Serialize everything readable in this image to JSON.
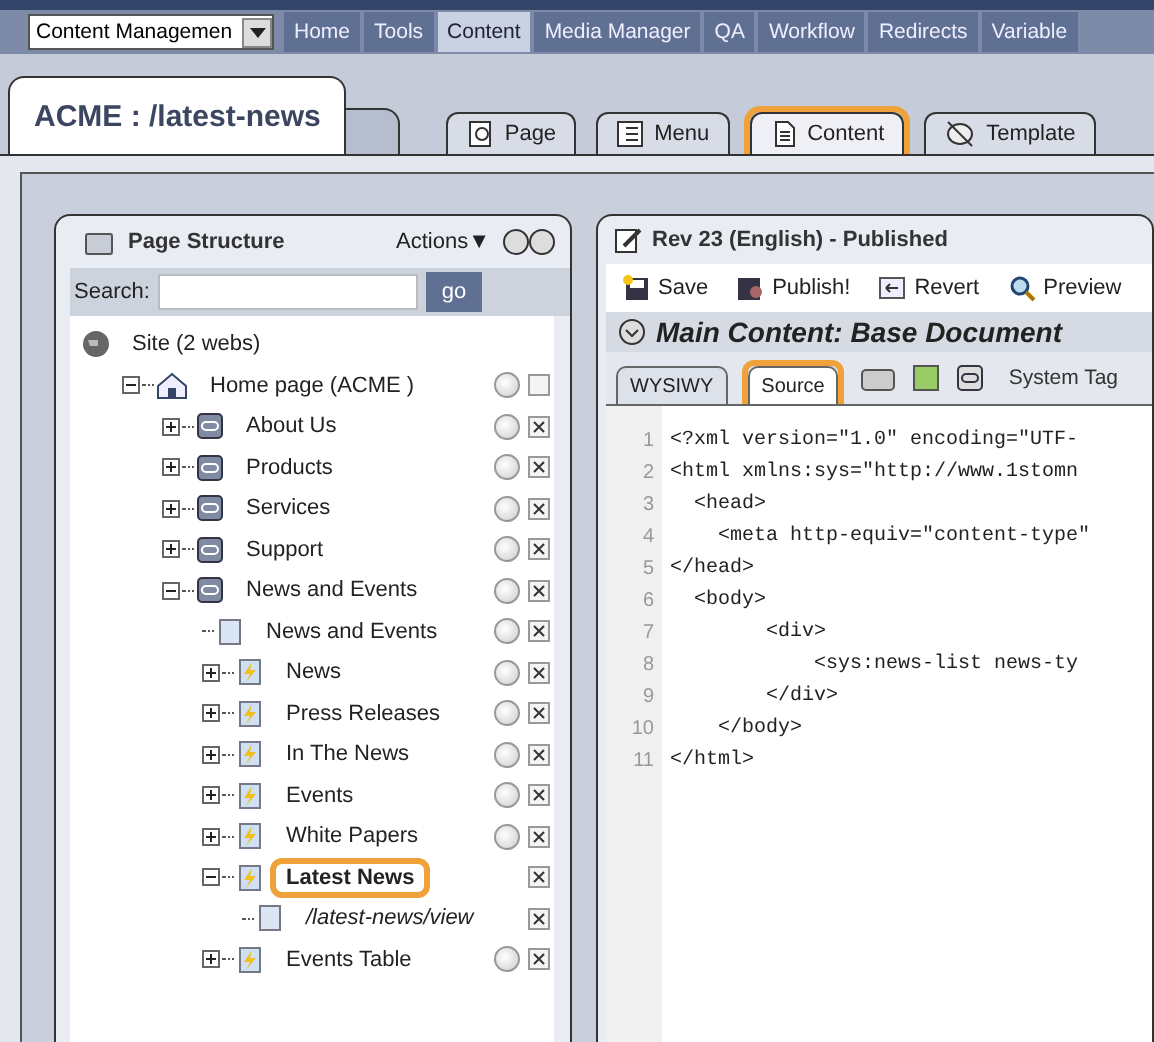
{
  "menu_bar": {
    "module_select": "Content Managemen",
    "items": [
      {
        "label": "Home",
        "selected": false
      },
      {
        "label": "Tools",
        "selected": false
      },
      {
        "label": "Content",
        "selected": true
      },
      {
        "label": "Media Manager",
        "selected": false
      },
      {
        "label": "QA",
        "selected": false
      },
      {
        "label": "Workflow",
        "selected": false
      },
      {
        "label": "Redirects",
        "selected": false
      },
      {
        "label": "Variable",
        "selected": false
      }
    ]
  },
  "page_title": "ACME : /latest-news",
  "view_tabs": [
    {
      "label": "Page",
      "kind": "page",
      "selected": false,
      "highlighted": false
    },
    {
      "label": "Menu",
      "kind": "menu",
      "selected": false,
      "highlighted": false
    },
    {
      "label": "Content",
      "kind": "content",
      "selected": true,
      "highlighted": true
    },
    {
      "label": "Template",
      "kind": "template",
      "selected": false,
      "highlighted": false
    }
  ],
  "page_structure": {
    "title": "Page Structure",
    "actions": "Actions▼",
    "search_label": "Search:",
    "search_button": "go",
    "tree": [
      {
        "label": "Site (2 webs)",
        "kind": "globe",
        "selected": false,
        "highlighted": false,
        "children": [
          {
            "label": "Home page (ACME )",
            "kind": "home",
            "expanded": true,
            "radio": true,
            "checked": false,
            "selected": false,
            "highlighted": false,
            "children": [
              {
                "label": "About Us",
                "kind": "link",
                "expanded": false,
                "radio": true,
                "checked": true,
                "selected": false,
                "highlighted": false
              },
              {
                "label": "Products",
                "kind": "link",
                "expanded": false,
                "radio": true,
                "checked": true,
                "selected": false,
                "highlighted": false
              },
              {
                "label": "Services",
                "kind": "link",
                "expanded": false,
                "radio": true,
                "checked": true,
                "selected": false,
                "highlighted": false
              },
              {
                "label": "Support",
                "kind": "link",
                "expanded": false,
                "radio": true,
                "checked": true,
                "selected": false,
                "highlighted": false
              },
              {
                "label": "News and Events",
                "kind": "link",
                "expanded": true,
                "radio": true,
                "checked": true,
                "selected": false,
                "highlighted": false,
                "children": [
                  {
                    "label": "News and Events",
                    "kind": "page",
                    "radio": true,
                    "checked": true,
                    "selected": false,
                    "highlighted": false
                  },
                  {
                    "label": "News",
                    "kind": "dynamic",
                    "expanded": false,
                    "radio": true,
                    "checked": true,
                    "selected": false,
                    "highlighted": false
                  },
                  {
                    "label": "Press Releases",
                    "kind": "dynamic",
                    "expanded": false,
                    "radio": true,
                    "checked": true,
                    "selected": false,
                    "highlighted": false
                  },
                  {
                    "label": "In The News",
                    "kind": "dynamic",
                    "expanded": false,
                    "radio": true,
                    "checked": true,
                    "selected": false,
                    "highlighted": false
                  },
                  {
                    "label": "Events",
                    "kind": "dynamic",
                    "expanded": false,
                    "radio": true,
                    "checked": true,
                    "selected": false,
                    "highlighted": false
                  },
                  {
                    "label": "White Papers",
                    "kind": "dynamic",
                    "expanded": false,
                    "radio": true,
                    "checked": true,
                    "selected": false,
                    "highlighted": false
                  },
                  {
                    "label": "Latest News",
                    "kind": "dynamic",
                    "expanded": true,
                    "radio": false,
                    "checked": true,
                    "selected": true,
                    "highlighted": true,
                    "children": [
                      {
                        "label": "/latest-news/view",
                        "kind": "page",
                        "radio": false,
                        "checked": true,
                        "selected": false,
                        "highlighted": false,
                        "italic": true
                      }
                    ]
                  },
                  {
                    "label": "Events Table",
                    "kind": "dynamic",
                    "expanded": false,
                    "radio": true,
                    "checked": true,
                    "selected": false,
                    "highlighted": false
                  }
                ]
              }
            ]
          }
        ]
      }
    ]
  },
  "editor": {
    "revision": "Rev 23 (English) - Published",
    "toolbar": [
      {
        "label": "Save",
        "kind": "save"
      },
      {
        "label": "Publish!",
        "kind": "publish"
      },
      {
        "label": "Revert",
        "kind": "revert"
      },
      {
        "label": "Preview",
        "kind": "preview"
      }
    ],
    "section_title": "Main Content: Base Document",
    "mode_tabs": [
      {
        "label": "WYSIWY",
        "selected": false,
        "highlighted": false
      },
      {
        "label": "Source",
        "selected": true,
        "highlighted": true
      }
    ],
    "system_tags": "System Tag",
    "code_lines": [
      {
        "number": "1",
        "text": "<?xml version=\"1.0\" encoding=\"UTF-"
      },
      {
        "number": "2",
        "text": "<html xmlns:sys=\"http://www.1stomn"
      },
      {
        "number": "3",
        "text": "  <head>"
      },
      {
        "number": "4",
        "text": "    <meta http-equiv=\"content-type\""
      },
      {
        "number": "5",
        "text": "</head>"
      },
      {
        "number": "6",
        "text": "  <body>"
      },
      {
        "number": "7",
        "text": "        <div>"
      },
      {
        "number": "8",
        "text": "            <sys:news-list news-ty"
      },
      {
        "number": "9",
        "text": "        </div>"
      },
      {
        "number": "10",
        "text": "    </body>"
      },
      {
        "number": "11",
        "text": "</html>"
      }
    ]
  }
}
